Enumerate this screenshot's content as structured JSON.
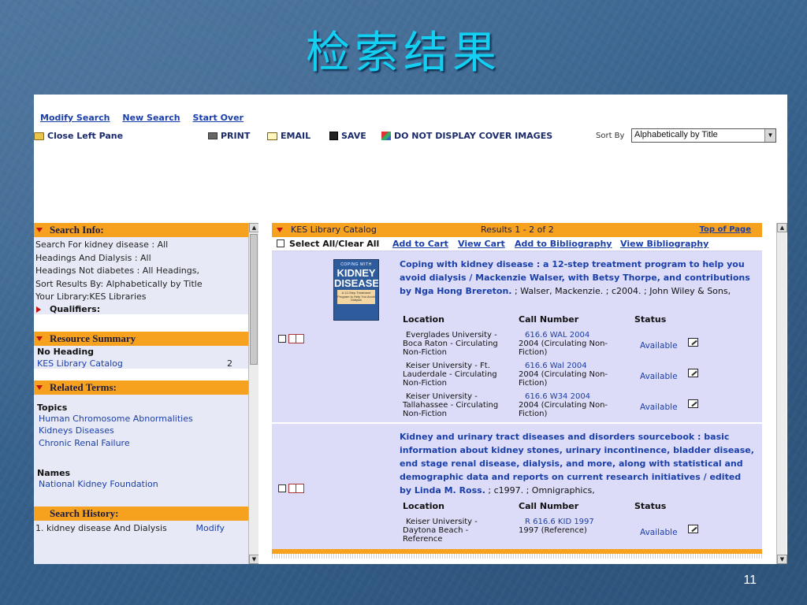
{
  "slide": {
    "title": "检索结果",
    "number": "11"
  },
  "top_links": {
    "modify": "Modify Search",
    "new": "New Search",
    "start_over": "Start Over"
  },
  "toolbar": {
    "close_left": "Close Left Pane",
    "print": "PRINT",
    "email": "EMAIL",
    "save": "SAVE",
    "no_cover": "DO NOT DISPLAY COVER IMAGES",
    "sort_by": "Sort By",
    "sort_value": "Alphabetically by Title"
  },
  "left": {
    "search_info_title": "Search Info:",
    "search_info_lines": [
      "Search For kidney disease : All",
      "Headings And Dialysis : All",
      "Headings Not diabetes : All Headings,",
      "Sort Results By: Alphabetically by Title",
      "Your Library:KES Libraries"
    ],
    "qualifiers": "Qualifiers:",
    "resource_title": "Resource Summary",
    "no_heading": "No Heading",
    "resource_item": "KES Library Catalog",
    "resource_count": "2",
    "related_title": "Related Terms:",
    "topics_label": "Topics",
    "topics": [
      "Human Chromosome Abnormalities",
      "Kidneys Diseases",
      "Chronic Renal Failure"
    ],
    "names_label": "Names",
    "names": [
      "National Kidney Foundation"
    ],
    "history_title": "Search History:",
    "history_item": "1. kidney disease And Dialysis",
    "history_modify": "Modify"
  },
  "right": {
    "catalog": "KES Library Catalog",
    "results": "Results 1 - 2 of 2",
    "top_of_page": "Top of Page",
    "select_all": "Select All/Clear All",
    "add_to_cart": "Add to Cart",
    "view_cart": "View Cart",
    "add_bib": "Add to Bibliography",
    "view_bib": "View Bibliography",
    "col_location": "Location",
    "col_call": "Call Number",
    "col_status": "Status",
    "records": [
      {
        "title_link": "Coping with kidney disease : a 12-step treatment program to help you avoid dialysis / Mackenzie Walser, with Betsy Thorpe, and contributions by Nga Hong Brereton.",
        "title_rest": " ; Walser, Mackenzie. ; c2004. ; John Wiley & Sons,",
        "cover": {
          "top": "COPING WITH",
          "big1": "KIDNEY",
          "big2": "DISEASE",
          "sub": "A 12-Step Treatment Program to Help You Avoid Dialysis"
        },
        "holdings": [
          {
            "loc": [
              "Everglades University -",
              "Boca Raton - Circulating",
              "Non-Fiction"
            ],
            "cn": "616.6 WAL 2004",
            "cn2": [
              "2004 (Circulating Non-",
              "Fiction)"
            ],
            "status": "Available"
          },
          {
            "loc": [
              "Keiser University - Ft.",
              "Lauderdale - Circulating",
              "Non-Fiction"
            ],
            "cn": "616.6 Wal 2004",
            "cn2": [
              "2004 (Circulating Non-",
              "Fiction)"
            ],
            "status": "Available"
          },
          {
            "loc": [
              "Keiser University -",
              "Tallahassee - Circulating",
              "Non-Fiction"
            ],
            "cn": "616.6 W34 2004",
            "cn2": [
              "2004 (Circulating Non-",
              "Fiction)"
            ],
            "status": "Available"
          }
        ]
      },
      {
        "title_link": "Kidney and urinary tract diseases and disorders sourcebook : basic information about kidney stones, urinary incontinence, bladder disease, end stage renal disease, dialysis, and more, along with statistical and demographic data and reports on current research initiatives / edited by Linda M. Ross.",
        "title_rest": " ; c1997. ; Omnigraphics,",
        "holdings": [
          {
            "loc": [
              "Keiser University -",
              "Daytona Beach -",
              "Reference"
            ],
            "cn": "R 616.6 KID 1997",
            "cn2": [
              "1997 (Reference)"
            ],
            "status": "Available"
          }
        ]
      }
    ]
  }
}
